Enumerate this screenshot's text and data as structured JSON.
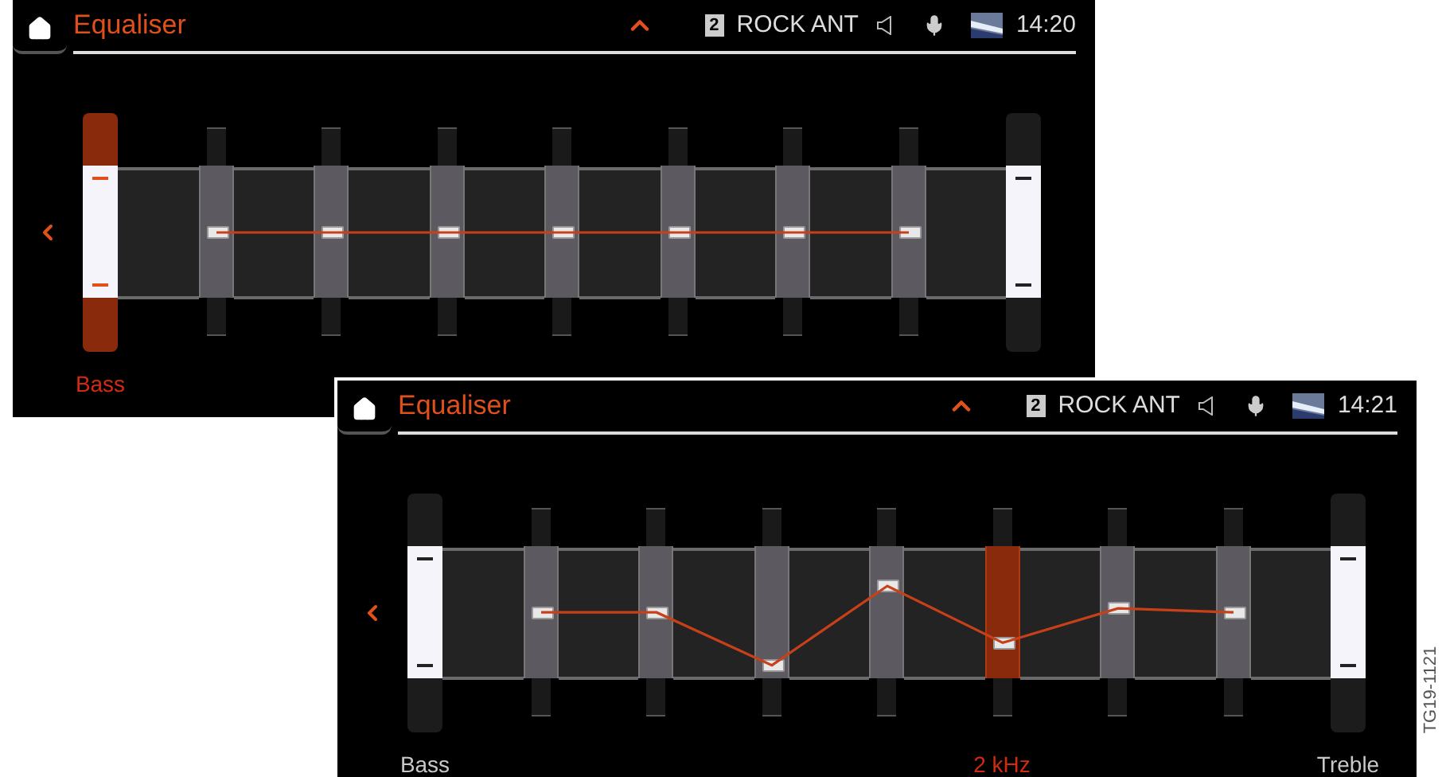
{
  "screens": [
    {
      "title": "Equaliser",
      "preset_number": "2",
      "source": "ROCK ANT",
      "time": "14:20",
      "sliders": [
        {
          "kind": "tone",
          "selected": true,
          "label": "Bass"
        },
        {
          "kind": "band",
          "selected": false,
          "level": 0.5
        },
        {
          "kind": "band",
          "selected": false,
          "level": 0.5
        },
        {
          "kind": "band",
          "selected": false,
          "level": 0.5
        },
        {
          "kind": "band",
          "selected": false,
          "level": 0.5
        },
        {
          "kind": "band",
          "selected": false,
          "level": 0.5
        },
        {
          "kind": "band",
          "selected": false,
          "level": 0.5
        },
        {
          "kind": "band",
          "selected": false,
          "level": 0.5
        },
        {
          "kind": "tone",
          "selected": false
        }
      ]
    },
    {
      "title": "Equaliser",
      "preset_number": "2",
      "source": "ROCK ANT",
      "time": "14:21",
      "sliders": [
        {
          "kind": "tone",
          "selected": false,
          "label": "Bass"
        },
        {
          "kind": "band",
          "selected": false,
          "level": 0.5
        },
        {
          "kind": "band",
          "selected": false,
          "level": 0.5
        },
        {
          "kind": "band",
          "selected": false,
          "level": 0.1
        },
        {
          "kind": "band",
          "selected": false,
          "level": 0.7
        },
        {
          "kind": "band",
          "selected": true,
          "level": 0.27,
          "label": "2 kHz"
        },
        {
          "kind": "band",
          "selected": false,
          "level": 0.53
        },
        {
          "kind": "band",
          "selected": false,
          "level": 0.5
        },
        {
          "kind": "tone",
          "selected": false,
          "label": "Treble"
        }
      ]
    }
  ],
  "figure_code": "TG19-1121"
}
